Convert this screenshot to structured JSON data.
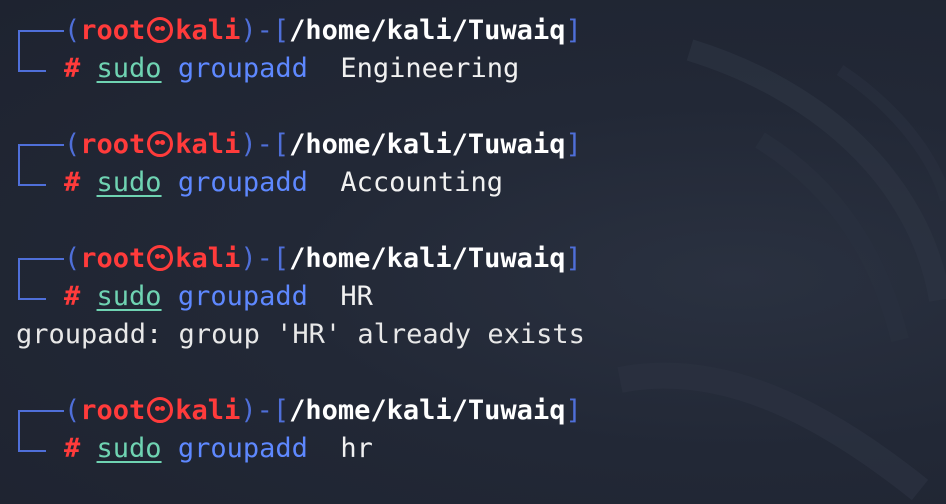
{
  "prompt": {
    "open_paren": "(",
    "user": "root",
    "host": "kali",
    "close_paren_dash": ")-[",
    "path": "/home/kali/Tuwaiq",
    "close_bracket": "]",
    "hash": "#",
    "sudo": "sudo",
    "command": "groupadd"
  },
  "entries": [
    {
      "arg": " Engineering",
      "output": ""
    },
    {
      "arg": " Accounting",
      "output": ""
    },
    {
      "arg": " HR",
      "output": "groupadd: group 'HR' already exists"
    },
    {
      "arg": " hr",
      "output": ""
    }
  ],
  "icons": {
    "prompt_symbol": "kali-skull-icon"
  },
  "colors": {
    "background": "#1f2430",
    "prompt_blue": "#4f6fd9",
    "prompt_red": "#ff3b3b",
    "sudo_cyan": "#6fd3b2",
    "command_blue": "#5e88ff",
    "text": "#e6e6e6"
  }
}
